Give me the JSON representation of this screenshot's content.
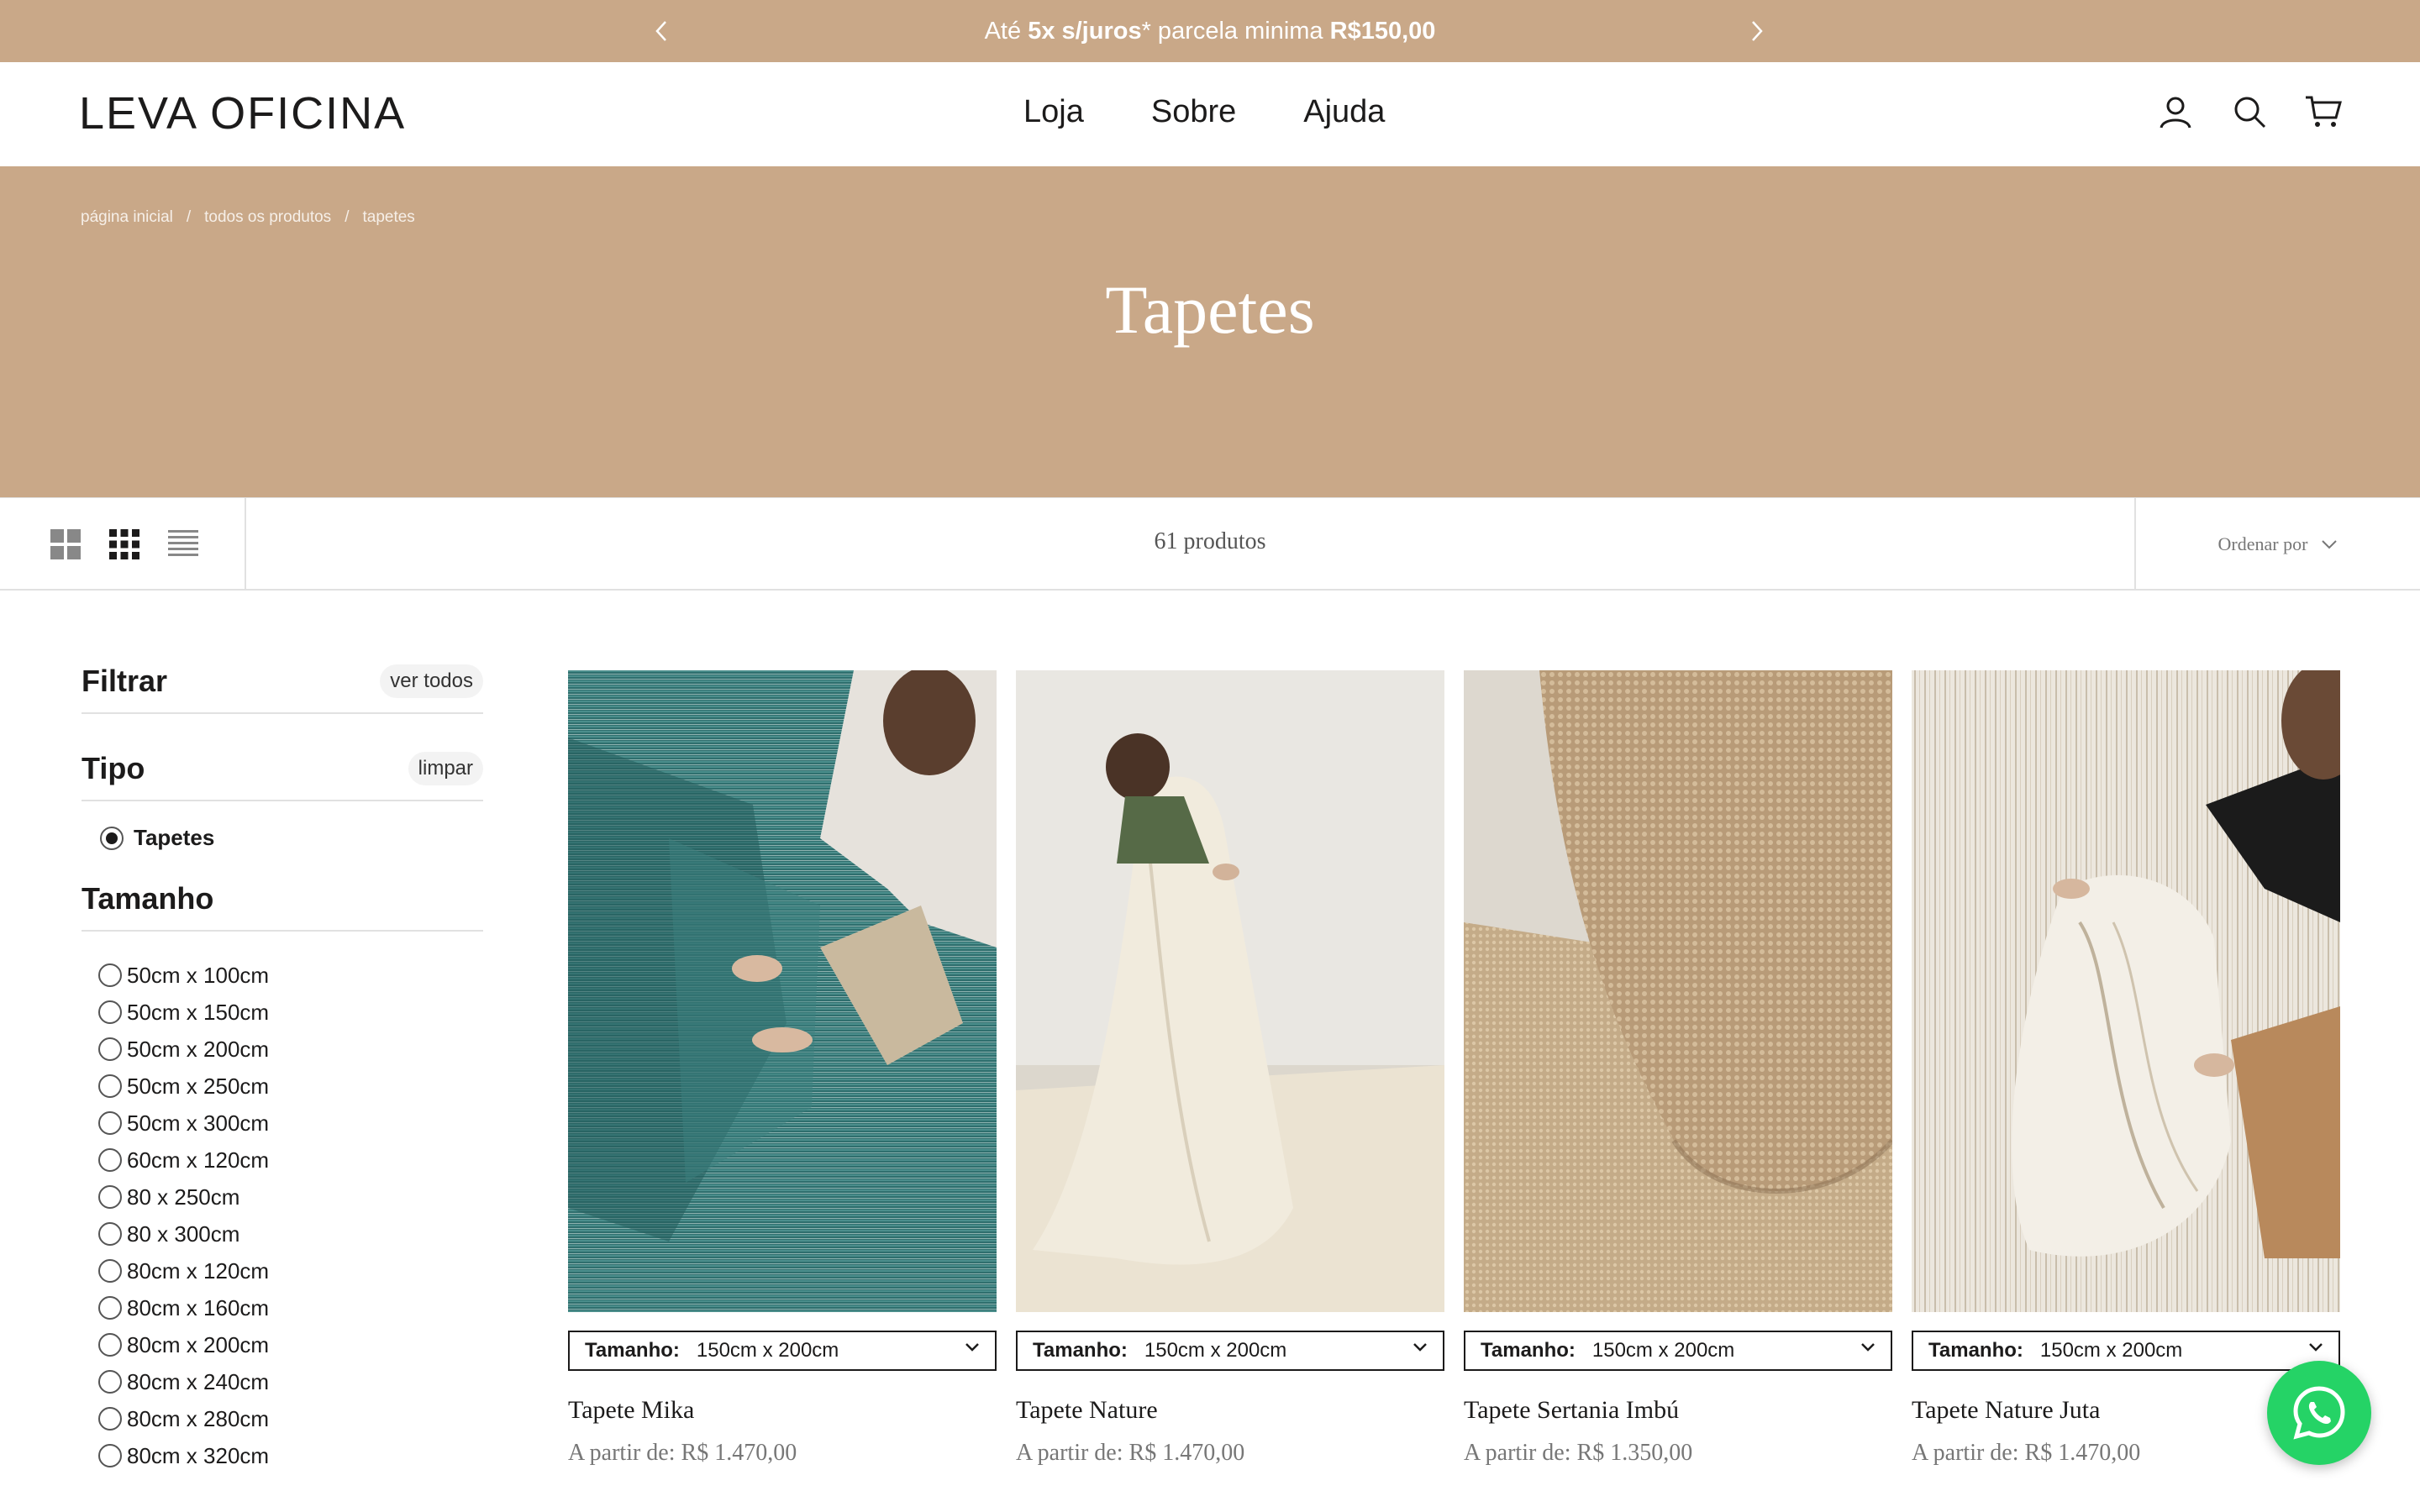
{
  "announcement": {
    "prefix": "Até ",
    "bold1": "5x s/juros",
    "middle": "* parcela minima ",
    "bold2": "R$150,00"
  },
  "header": {
    "logo": "LEVA OFICINA",
    "nav": [
      "Loja",
      "Sobre",
      "Ajuda"
    ],
    "icons": [
      "account-icon",
      "search-icon",
      "cart-icon"
    ]
  },
  "hero": {
    "breadcrumb": [
      "página inicial",
      "todos os produtos",
      "tapetes"
    ],
    "separator": "/",
    "title": "Tapetes"
  },
  "toolbar": {
    "product_count": "61 produtos",
    "sort_label": "Ordenar por"
  },
  "sidebar": {
    "filter_title": "Filtrar",
    "view_all": "ver todos",
    "type_title": "Tipo",
    "clear": "limpar",
    "type_option": "Tapetes",
    "size_title": "Tamanho",
    "sizes": [
      "50cm x 100cm",
      "50cm x 150cm",
      "50cm x 200cm",
      "50cm x 250cm",
      "50cm x 300cm",
      "60cm x 120cm",
      "80 x 250cm",
      "80 x 300cm",
      "80cm x 120cm",
      "80cm x 160cm",
      "80cm x 200cm",
      "80cm x 240cm",
      "80cm x 280cm",
      "80cm x 320cm"
    ]
  },
  "products": [
    {
      "name": "Tapete Mika",
      "price": "A partir de: R$ 1.470,00",
      "size_label": "Tamanho:",
      "size_value": "150cm x 200cm"
    },
    {
      "name": "Tapete Nature",
      "price": "A partir de: R$ 1.470,00",
      "size_label": "Tamanho:",
      "size_value": "150cm x 200cm"
    },
    {
      "name": "Tapete Sertania Imbú",
      "price": "A partir de: R$ 1.350,00",
      "size_label": "Tamanho:",
      "size_value": "150cm x 200cm"
    },
    {
      "name": "Tapete Nature Juta",
      "price": "A partir de: R$ 1.470,00",
      "size_label": "Tamanho:",
      "size_value": "150cm x 200cm"
    }
  ],
  "colors": {
    "accent": "#c9a888",
    "text": "#1c1b1b",
    "whatsapp": "#25d366"
  }
}
